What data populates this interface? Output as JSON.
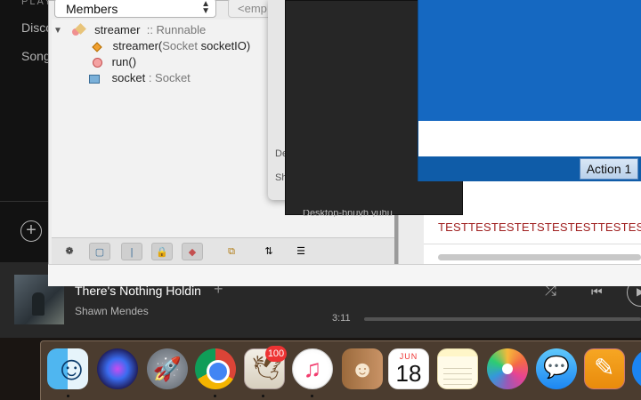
{
  "spotify": {
    "sidebar": {
      "heading": "PLAY",
      "items": [
        "Disco",
        "Song"
      ],
      "add_icon": "plus-circle-icon"
    },
    "now_playing": {
      "track": "There's Nothing Holdin",
      "artist": "Shawn Mendes",
      "elapsed": "3:11",
      "add_icon": "plus-icon",
      "controls": [
        "shuffle-icon",
        "previous-icon",
        "play-icon"
      ]
    }
  },
  "navigator": {
    "filter_select": "Members",
    "empty_filter": "<emp",
    "tree": {
      "class_name": "streamer",
      "class_sep": ":: ",
      "class_super": "Runnable",
      "members": [
        {
          "name": "streamer(",
          "type_part": "Socket ",
          "param": "socketIO)",
          "icon": "constructor-diamond-icon"
        },
        {
          "name": "run()",
          "type_part": "",
          "param": "",
          "icon": "method-circle-icon"
        },
        {
          "name": "socket",
          "type_part": " : Socket",
          "param": "",
          "icon": "field-lock-icon"
        }
      ]
    },
    "toolbar_icons": [
      "show-inherited-icon",
      "fields-filter-icon",
      "static-filter-icon",
      "non-public-filter-icon",
      "inner-classes-icon",
      "fqn-icon",
      "sort-by-name-icon",
      "sort-by-source-icon"
    ]
  },
  "dialog_gray": {
    "labels": [
      "De",
      "Sh"
    ]
  },
  "dark_window": {
    "text": "Desktop-bnuyh yuhu"
  },
  "blue_window": {
    "action_button": "Action 1"
  },
  "editor": {
    "output": "TESTTESTESTETSTESTESTTESTEST"
  },
  "dock": {
    "apps": [
      "finder",
      "siri",
      "launchpad",
      "chrome",
      "mail",
      "itunes",
      "contacts",
      "calendar",
      "notes",
      "photos",
      "messages",
      "pages",
      "app-store"
    ],
    "mail_badge": "100",
    "calendar_month": "JUN",
    "calendar_day": "18"
  }
}
